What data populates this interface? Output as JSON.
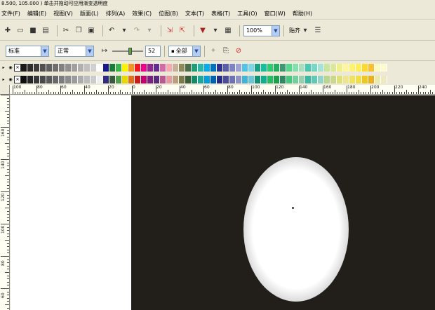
{
  "window": {
    "title": "8.500, 105.000 )   单击并拖动可应用渐变透明度"
  },
  "menu": [
    {
      "label": "文件(F)"
    },
    {
      "label": "编辑(E)"
    },
    {
      "label": "视图(V)"
    },
    {
      "label": "版面(L)"
    },
    {
      "label": "排列(A)"
    },
    {
      "label": "效果(C)"
    },
    {
      "label": "位图(B)"
    },
    {
      "label": "文本(T)"
    },
    {
      "label": "表格(T)"
    },
    {
      "label": "工具(O)"
    },
    {
      "label": "窗口(W)"
    },
    {
      "label": "帮助(H)"
    }
  ],
  "toolbar1": {
    "zoom_value": "100%",
    "snap_label": "贴齐"
  },
  "toolbar2": {
    "transparency_type": "标准",
    "merge_mode": "正常",
    "opacity_value": "52",
    "apply_to": "全部"
  },
  "palette_row1": [
    "#1a1a1a",
    "#2d2d2d",
    "#3c3c3c",
    "#505050",
    "#5f5f5f",
    "#6e6e6e",
    "#808080",
    "#909090",
    "#a0a0a0",
    "#b0b0b0",
    "#c0c0c0",
    "#d0d0d0",
    "#ffffff",
    "#1a1a8c",
    "#1f7a3a",
    "#39b54a",
    "#fff200",
    "#f7941d",
    "#ed1c24",
    "#ec008c",
    "#92278f",
    "#662d91",
    "#d16ba5",
    "#f9a7b0",
    "#c7b299",
    "#8b8b5a",
    "#4a6d4a",
    "#1d9e74",
    "#2bb5a8",
    "#00aeef",
    "#0072bc",
    "#2e3192",
    "#5b5ea6",
    "#7d82c4",
    "#9ea3d4",
    "#4fc3e8",
    "#7fd4e8",
    "#16a085",
    "#1abc9c",
    "#2ecc71",
    "#27ae60",
    "#3d9970",
    "#58d68d",
    "#82e0aa",
    "#a9dfbf",
    "#48c9b0",
    "#76d7c4",
    "#a3e4d7",
    "#c8e6a0",
    "#dbe89a",
    "#f0f08a",
    "#fff59d",
    "#fff176",
    "#ffee58",
    "#fdd835",
    "#fbc02d",
    "#f9f9c0",
    "#fefad0"
  ],
  "palette_row2": [
    "#101010",
    "#252525",
    "#383838",
    "#4a4a4a",
    "#5a5a5a",
    "#6a6a6a",
    "#7c7c7c",
    "#8c8c8c",
    "#9c9c9c",
    "#acacac",
    "#bcbcbc",
    "#cccccc",
    "#f0f0f0",
    "#312e81",
    "#3a5a40",
    "#52a04b",
    "#e8d800",
    "#e0701a",
    "#c41e1e",
    "#c4006e",
    "#7a2080",
    "#5a2a7a",
    "#b85a90",
    "#e89aa0",
    "#b8a080",
    "#7a7a4a",
    "#3a5d3a",
    "#158a64",
    "#22a598",
    "#009edf",
    "#0062ac",
    "#262a80",
    "#4b4e96",
    "#6d72b4",
    "#8e93c4",
    "#3fb3d8",
    "#6fc4d8",
    "#129075",
    "#15ac8c",
    "#26bc61",
    "#1f9e50",
    "#2d8960",
    "#48c67d",
    "#72d09a",
    "#99cfaf",
    "#38b9a0",
    "#66c7b4",
    "#93d4c7",
    "#b8d690",
    "#cbd88a",
    "#e0e07a",
    "#efe58d",
    "#efe166",
    "#efde48",
    "#edc825",
    "#ebb01d",
    "#e9e9b0",
    "#eeeac0"
  ],
  "ruler_h": {
    "labels": [
      "100",
      "80",
      "60",
      "40",
      "20",
      "0",
      "20",
      "40",
      "60",
      "80",
      "100",
      "120",
      "140",
      "160",
      "180",
      "200",
      "220",
      "240"
    ]
  },
  "ruler_v": {
    "labels": [
      "160",
      "140",
      "120",
      "100",
      "80",
      "60"
    ]
  }
}
